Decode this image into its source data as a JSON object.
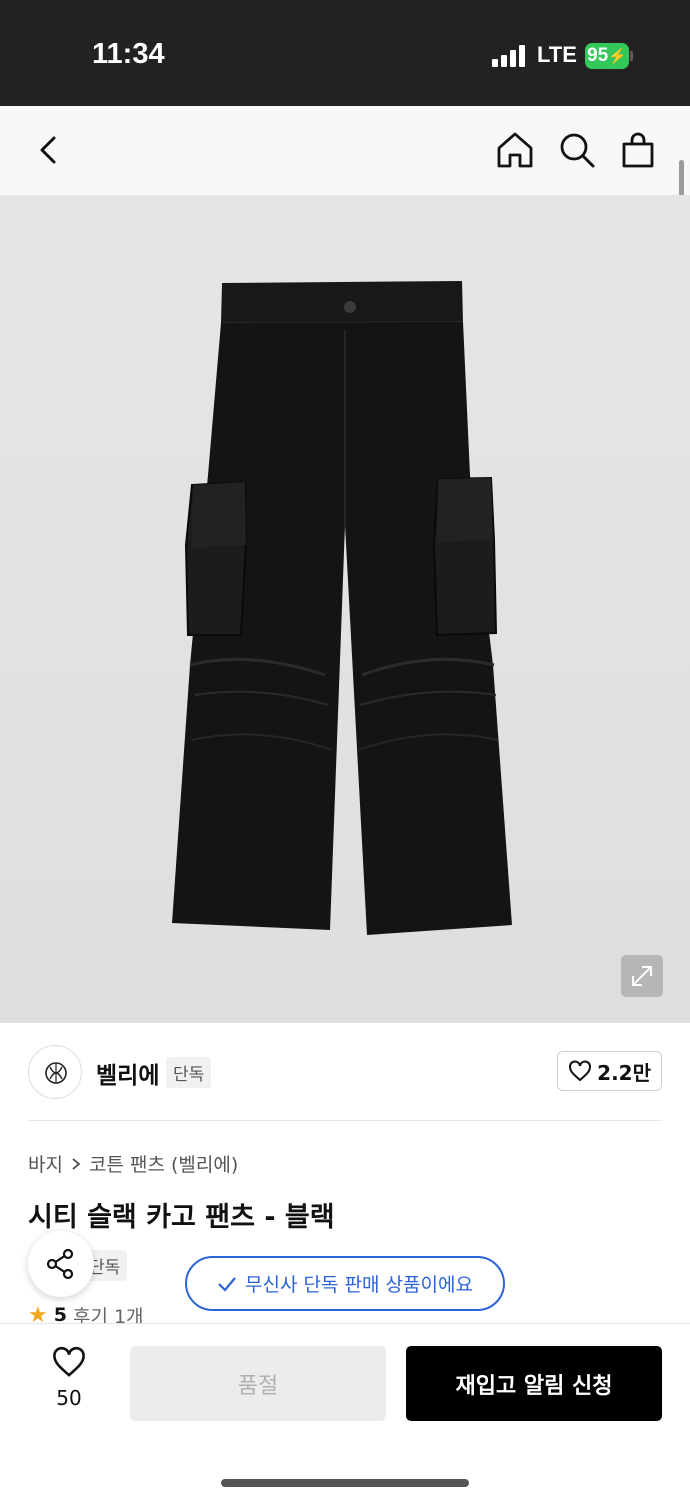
{
  "status_bar": {
    "time": "11:34",
    "network": "LTE",
    "battery": "95"
  },
  "top_nav": {
    "icons": [
      "back-icon",
      "home-icon",
      "search-icon",
      "shopping-bag-icon"
    ]
  },
  "brand": {
    "name": "벨리에",
    "tag": "단독",
    "likes": "2.2만"
  },
  "breadcrumb": {
    "category": "바지",
    "subcategory": "코튼 팬츠 (벨리에)"
  },
  "product": {
    "title": "시티 슬랙 카고 팬츠 - 블랙",
    "tag": "단독",
    "rating": "5",
    "reviews": "후기 1개"
  },
  "toast": {
    "text": "무신사 단독 판매 상품이에요"
  },
  "bottom_bar": {
    "wish_count": "50",
    "soldout_label": "품절",
    "restock_label": "재입고 알림 신청"
  },
  "colors": {
    "status_bg": "#222222",
    "accent_blue": "#2b63d9",
    "battery_green": "#34c759",
    "primary_button": "#000000",
    "disabled_button": "#ececec",
    "star": "#f5a623"
  }
}
